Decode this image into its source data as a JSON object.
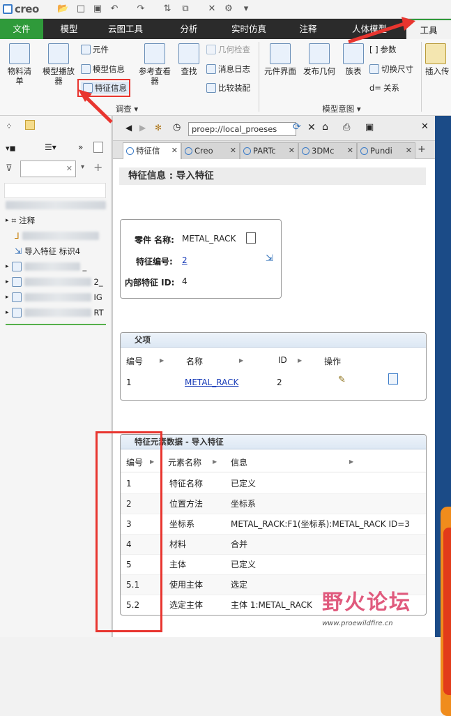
{
  "app": {
    "logo": "creo"
  },
  "tabs": [
    "文件",
    "模型",
    "云图工具",
    "分析",
    "实时仿真",
    "注释",
    "人体模型",
    "工具"
  ],
  "ribbon": {
    "bom": "物料清单",
    "model_player": "模型播放器",
    "component": "元件",
    "model_info": "模型信息",
    "feature_info": "特征信息",
    "ref_viewer": "参考查看器",
    "find": "查找",
    "geom_check": "几何检查",
    "msg_log": "消息日志",
    "compare": "比较装配",
    "comp_interface": "元件界面",
    "publish_geom": "发布几何",
    "family_table": "族表",
    "parameters": "参数",
    "switch_dim": "切换尺寸",
    "relations": "关系",
    "insert": "插入传",
    "group_investigate": "调查",
    "group_model_intent": "模型意图"
  },
  "left": {
    "tree": [
      "注释",
      "导入特征 标识4"
    ],
    "partial": [
      "_",
      "2_",
      "IG",
      "RT"
    ]
  },
  "browser": {
    "url": "proep://local_proeses",
    "tabs": [
      "特征信",
      "Creo",
      "PARTc",
      "3DMc",
      "Pundi"
    ],
    "page_title": "特征信息 : 导入特征",
    "part_name_label": "零件 名称:",
    "part_name": "METAL_RACK",
    "feature_id_label": "特征编号:",
    "feature_id": "2",
    "internal_id_label": "内部特征 ID:",
    "internal_id": "4",
    "parents": {
      "title": "父项",
      "headers": [
        "编号",
        "名称",
        "ID",
        "操作"
      ],
      "row": {
        "no": "1",
        "name": "METAL_RACK",
        "id": "2"
      }
    },
    "elements": {
      "title": "特征元素数据 - 导入特征",
      "headers": [
        "编号",
        "元素名称",
        "信息"
      ],
      "rows": [
        [
          "1",
          "特征名称",
          "已定义"
        ],
        [
          "2",
          "位置方法",
          "坐标系"
        ],
        [
          "3",
          "坐标系",
          "METAL_RACK:F1(坐标系):METAL_RACK ID=3"
        ],
        [
          "4",
          "材料",
          "合并"
        ],
        [
          "5",
          "主体",
          "已定义"
        ],
        [
          "5.1",
          "使用主体",
          "选定"
        ],
        [
          "5.2",
          "选定主体",
          "主体 1:METAL_RACK"
        ]
      ]
    }
  },
  "watermark": {
    "text": "野火论坛",
    "url": "www.proewildfire.cn"
  },
  "colors": {
    "file_tab": "#2f9a3a",
    "accent_red": "#e8352f",
    "link": "#1a3db8"
  }
}
